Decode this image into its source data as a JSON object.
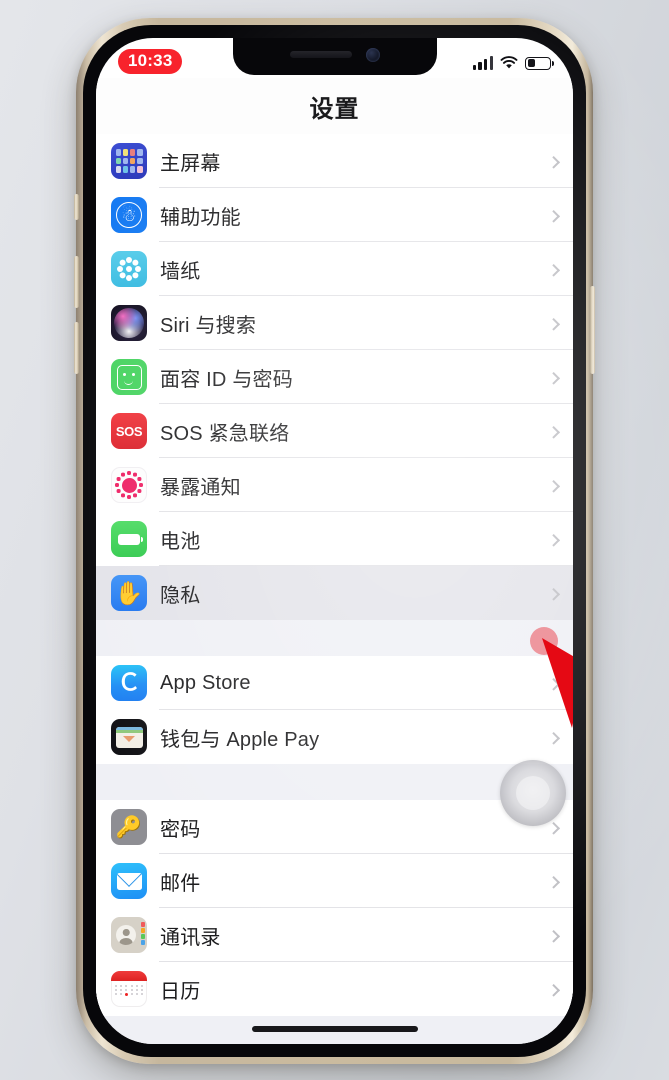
{
  "status_bar": {
    "recording_time": "10:33",
    "recording_pill_color": "#F8232C",
    "signal_icon": "cellular-signal-icon",
    "wifi_icon": "wifi-icon",
    "battery_icon": "battery-icon",
    "battery_level_percent": 38
  },
  "nav": {
    "title": "设置"
  },
  "theme": {
    "list_background": "#EFF0F5",
    "row_background": "#FFFFFF",
    "row_selected_background": "#E3E3E9",
    "separator": "#E2E2E6",
    "label_color": "#1C1C1E",
    "chevron_color": "#BFBFC4",
    "phone_frame_color": "#CABB9F"
  },
  "groups": [
    {
      "rows": [
        {
          "label": "主屏幕",
          "icon": "home-screen-icon",
          "selected": false
        },
        {
          "label": "辅助功能",
          "icon": "accessibility-icon",
          "selected": false
        },
        {
          "label": "墙纸",
          "icon": "wallpaper-icon",
          "selected": false
        },
        {
          "label": "Siri 与搜索",
          "icon": "siri-icon",
          "selected": false
        },
        {
          "label": "面容 ID 与密码",
          "icon": "face-id-icon",
          "selected": false
        },
        {
          "label": "SOS 紧急联络",
          "icon": "emergency-sos-icon",
          "selected": false
        },
        {
          "label": "暴露通知",
          "icon": "exposure-notifications-icon",
          "selected": false
        },
        {
          "label": "电池",
          "icon": "battery-settings-icon",
          "selected": false
        },
        {
          "label": "隐私",
          "icon": "privacy-icon",
          "selected": true
        }
      ]
    },
    {
      "rows": [
        {
          "label": "App Store",
          "icon": "app-store-icon",
          "selected": false
        },
        {
          "label": "钱包与 Apple Pay",
          "icon": "wallet-icon",
          "selected": false
        }
      ]
    },
    {
      "rows": [
        {
          "label": "密码",
          "icon": "passwords-icon",
          "selected": false
        },
        {
          "label": "邮件",
          "icon": "mail-icon",
          "selected": false
        },
        {
          "label": "通讯录",
          "icon": "contacts-icon",
          "selected": false
        },
        {
          "label": "日历",
          "icon": "calendar-icon",
          "selected": false
        }
      ]
    }
  ],
  "overlays": {
    "assistive_touch": {
      "name": "assistive-touch-button"
    },
    "cursor": {
      "name": "mouse-cursor",
      "color": "#E50914",
      "target_row_label": "隐私"
    },
    "home_indicator": {
      "name": "home-indicator"
    }
  }
}
